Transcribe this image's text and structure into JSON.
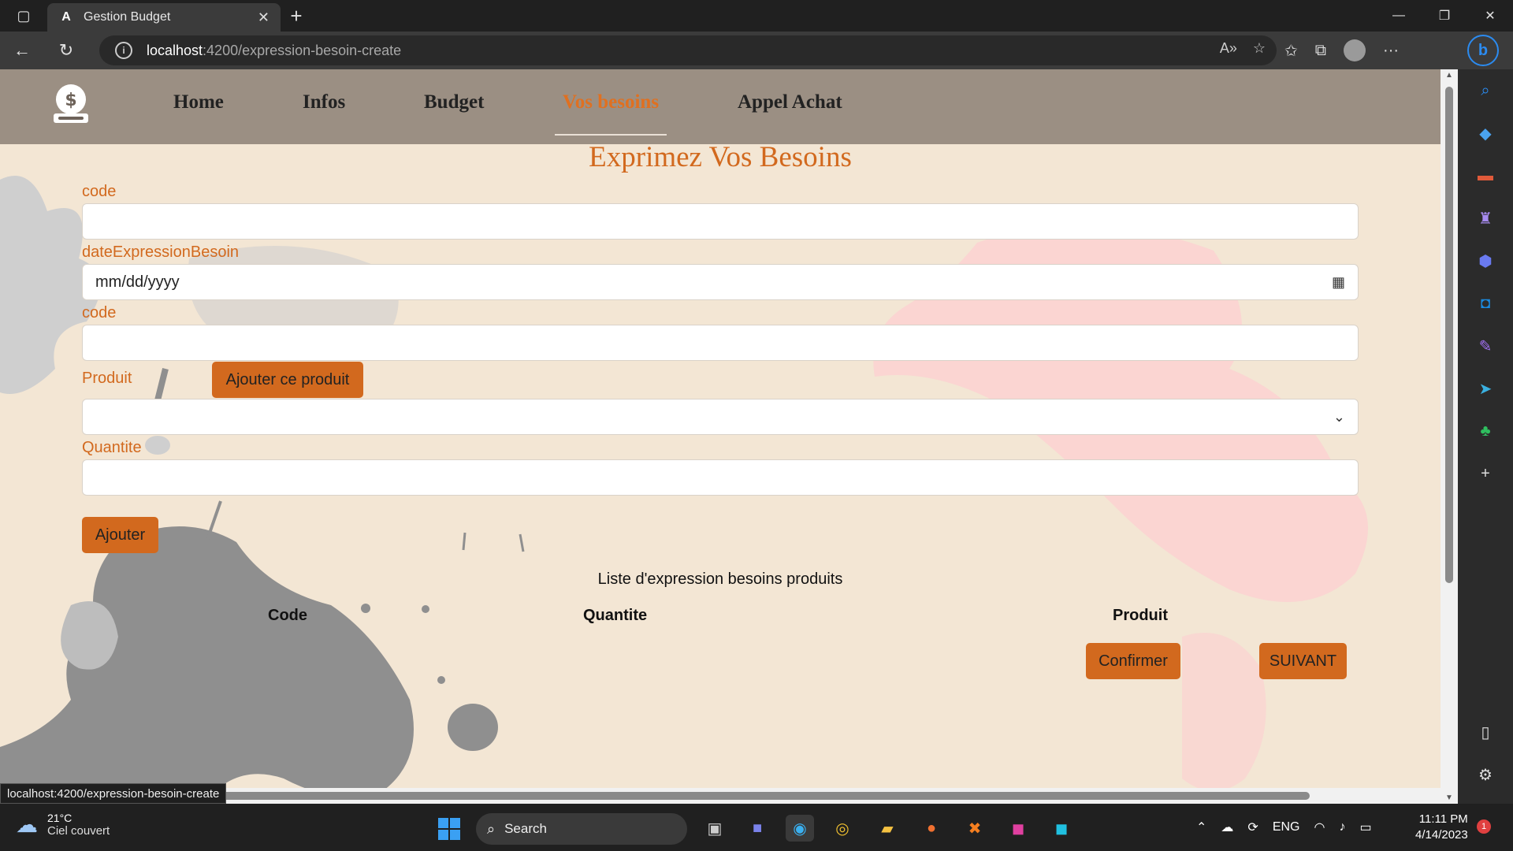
{
  "browser": {
    "tab_title": "Gestion Budget",
    "url_host": "localhost",
    "url_path": ":4200/expression-besoin-create",
    "status_url": "localhost:4200/expression-besoin-create"
  },
  "app": {
    "nav": {
      "home": "Home",
      "infos": "Infos",
      "budget": "Budget",
      "vos_besoins": "Vos besoins",
      "appel_achat": "Appel Achat"
    },
    "heading": "Exprimez Vos Besoins",
    "form": {
      "code_label": "code",
      "code_value": "",
      "date_label": "dateExpressionBesoin",
      "date_value": "mm/dd/yyyy",
      "code2_label": "code",
      "code2_value": "",
      "produit_label": "Produit",
      "add_product_button": "Ajouter ce produit",
      "produit_selected": "",
      "quantite_label": "Quantite",
      "quantite_value": "",
      "ajouter_button": "Ajouter"
    },
    "list": {
      "title": "Liste d'expression besoins produits",
      "columns": [
        "Code",
        "Quantite",
        "Produit"
      ]
    },
    "actions": {
      "confirmer": "Confirmer",
      "suivant": "SUIVANT"
    }
  },
  "taskbar": {
    "temperature": "21°C",
    "weather": "Ciel couvert",
    "search_placeholder": "Search",
    "language": "ENG",
    "time": "11:11 PM",
    "date": "4/14/2023",
    "notifications": "1"
  },
  "colors": {
    "accent": "#d2691e",
    "page_background": "#f3e6d4"
  }
}
